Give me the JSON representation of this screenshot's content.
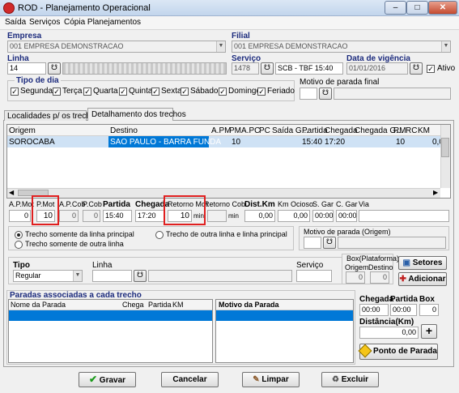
{
  "window": {
    "title": "ROD - Planejamento Operacional"
  },
  "menu": [
    "Saída",
    "Serviços",
    "Cópia Planejamentos"
  ],
  "empresa": {
    "label": "Empresa",
    "value": "001 EMPRESA DEMONSTRACAO"
  },
  "filial": {
    "label": "Filial",
    "value": "001 EMPRESA DEMONSTRACAO"
  },
  "linha": {
    "label": "Linha",
    "value": "14"
  },
  "servico": {
    "label": "Serviço",
    "code": "1478",
    "desc": "SCB - TBF 15:40"
  },
  "vigencia": {
    "label": "Data de vigência",
    "value": "01/01/2016"
  },
  "ativo": {
    "label": "Ativo",
    "checked": true
  },
  "tipo_dia": {
    "label": "Tipo de dia",
    "days": [
      "Segunda",
      "Terça",
      "Quarta",
      "Quinta",
      "Sexta",
      "Sábado",
      "Domingo",
      "Feriado"
    ]
  },
  "motivo_final": {
    "label": "Motivo de parada final"
  },
  "tabs": [
    "Localidades p/ os trechos",
    "Detalhamento dos trechos"
  ],
  "grid": {
    "headers": [
      "Origem",
      "Destino",
      "A.PM",
      "PM",
      "A.PC",
      "PC",
      "Saída G...",
      "Partida",
      "Chegada",
      "Chegada G...",
      "RM",
      "RC",
      "KM"
    ],
    "row": {
      "origem": "SOROCABA",
      "destino": "SAO PAULO - BARRA FUNDA",
      "pm": "10",
      "partida": "15:40",
      "chegada": "17:20",
      "rm": "10",
      "km": "0,0"
    }
  },
  "detail": {
    "labels": [
      "A.P.Mot",
      "P.Mot",
      "A.P.Cob",
      "P.Cob",
      "Partida",
      "Chegada",
      "Retorno Mot",
      "Retorno Cob",
      "Dist.Km",
      "Km Ocioso",
      "S. Gar",
      "C. Gar",
      "Via"
    ],
    "apmot": "0",
    "pmot": "10",
    "apcob": "0",
    "pcob": "0",
    "partida": "15:40",
    "chegada": "17:20",
    "ret_mot": "10",
    "ret_mot_unit": "min",
    "ret_cob_unit": "min",
    "dist": "0,00",
    "km_ocioso": "0,00",
    "sgar": "00:00",
    "cgar": "00:00"
  },
  "radios": [
    "Trecho somente da linha principal",
    "Trecho somente de outra linha",
    "Trecho de outra linha e linha principal"
  ],
  "motivo_origem": {
    "label": "Motivo de parada (Origem)"
  },
  "tipo": {
    "label": "Tipo",
    "value": "Regular"
  },
  "linha2": {
    "label": "Linha"
  },
  "servico2": {
    "label": "Serviço"
  },
  "box": {
    "label": "Box(Plataforma)",
    "origem_label": "Origem",
    "destino_label": "Destino",
    "origem": "0",
    "destino": "0"
  },
  "buttons": {
    "setores": "Setores",
    "adicionar": "Adicionar",
    "gravar": "Gravar",
    "cancelar": "Cancelar",
    "limpar": "Limpar",
    "excluir": "Excluir",
    "ponto": "Ponto de Parada"
  },
  "paradas": {
    "label": "Paradas associadas a cada trecho",
    "headers": [
      "Nome da Parada",
      "Chega",
      "Partida",
      "KM"
    ],
    "motivo_header": "Motivo da Parada"
  },
  "right": {
    "chegada_label": "Chegada",
    "partida_label": "Partida",
    "box_label": "Box",
    "chegada": "00:00",
    "partida": "00:00",
    "box": "0",
    "distancia_label": "Distância(Km)",
    "distancia": "0,00"
  },
  "colors": {
    "title_bg": "#c2d5ec",
    "selection": "#0078d7",
    "label_blue": "#1c2b7d",
    "highlight_box": "#e02020"
  }
}
